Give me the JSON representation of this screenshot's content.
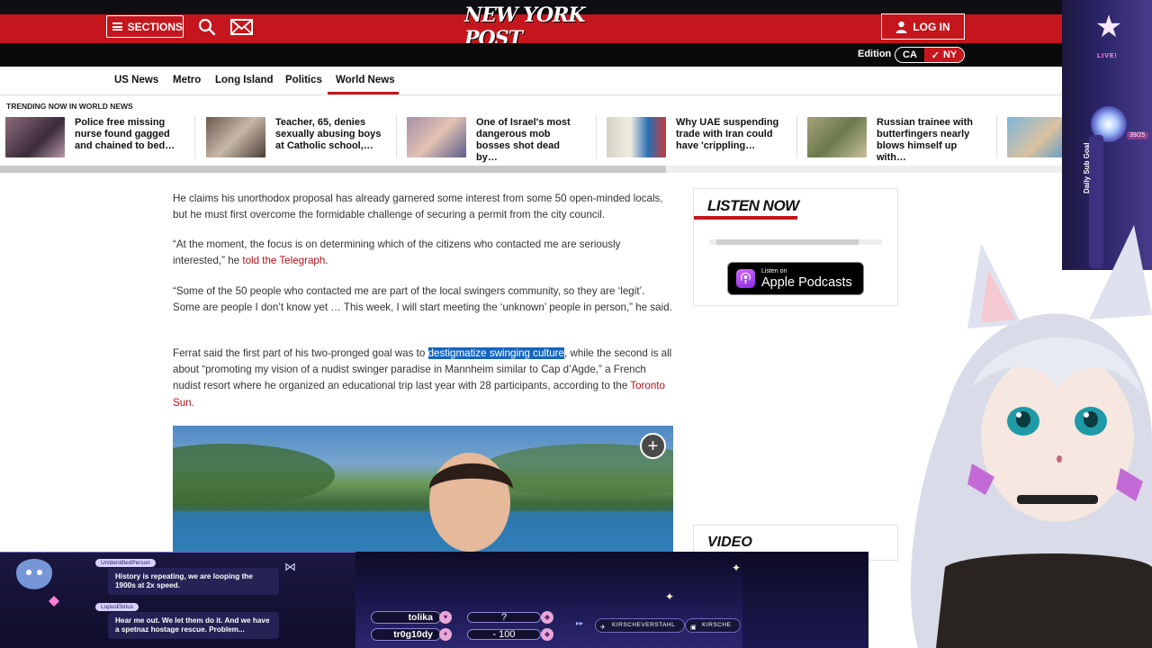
{
  "header": {
    "sections_label": "SECTIONS",
    "logo_text": "NEW YORK POST",
    "login_label": "LOG IN",
    "edition_label": "Edition",
    "edition_options": [
      "CA",
      "NY"
    ],
    "edition_selected": "NY"
  },
  "nav": {
    "items": [
      "US News",
      "Metro",
      "Long Island",
      "Politics",
      "World News"
    ],
    "active": "World News"
  },
  "trending": {
    "label": "TRENDING NOW IN WORLD NEWS",
    "items": [
      {
        "title": "Police free missing nurse found gagged and chained to bed…"
      },
      {
        "title": "Teacher, 65, denies sexually abusing boys at Catholic school,…"
      },
      {
        "title": "One of Israel's most dangerous mob bosses shot dead by…"
      },
      {
        "title": "Why UAE suspending trade with Iran could have 'crippling…"
      },
      {
        "title": "Russian trainee with butterfingers nearly blows himself up with…"
      }
    ]
  },
  "article": {
    "p1": "He claims his unorthodox proposal has already garnered some interest from some 50 open-minded locals, but he must first overcome the formidable challenge of securing a permit from the city council.",
    "p2_text": "“At the moment, the focus is on determining which of the citizens who contacted me are seriously interested,” he ",
    "p2_link": "told the Telegraph",
    "p2_end": ".",
    "p3": "“Some of the 50 people who contacted me are part of the local swingers community, so they are ‘legit’. Some are people I don’t know yet … This week, I will start meeting the ‘unknown’ people in person,” he said.",
    "p4_start": "Ferrat said the first part of his two-pronged goal was to ",
    "p4_highlight": "destigmatize swinging culture",
    "p4_middle": ", while the second is all about “promoting my vision of a nudist swinger paradise in Mannheim similar to Cap d’Agde,” a French nudist resort where he organized an educational trip last year with 28 participants, according to the ",
    "p4_link": "Toronto Sun",
    "p4_end": "."
  },
  "sidebar": {
    "listen_title": "LISTEN NOW",
    "podcast_small": "Listen on",
    "podcast_big": "Apple Podcasts",
    "video_title": "VIDEO"
  },
  "overlay": {
    "live_label": "LIVE!",
    "goal_label": "Daily Sub Goal",
    "goal_count": "39/25",
    "chat": [
      {
        "user": "UnidentifiedPerson",
        "message": "History is repeating, we are looping the 1900s at 2x speed."
      },
      {
        "user": "LupusEbrius",
        "message": "Hear me out. We let them do it. And we have a spetnaz hostage rescue. Problem..."
      }
    ],
    "donors": [
      {
        "name": "tolika",
        "amount": "?"
      },
      {
        "name": "tr0g10dy",
        "amount": "- 100"
      }
    ],
    "socials": [
      {
        "icon": "twitter-icon",
        "label": "KIRSCHEVERSTAHL"
      },
      {
        "icon": "twitch-icon",
        "label": "KIRSCHE"
      }
    ]
  },
  "colors": {
    "brand_red": "#c4161c",
    "link_red": "#b5121b",
    "highlight_blue": "#1565c0"
  }
}
